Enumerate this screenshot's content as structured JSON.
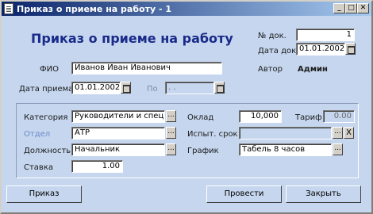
{
  "window": {
    "title": "Приказ о приеме на работу - 1"
  },
  "heading": "Приказ о приеме на работу",
  "doc_no": {
    "label": "№ док.",
    "value": "1"
  },
  "doc_date": {
    "label": "Дата док.",
    "value": "01.01.2002"
  },
  "author": {
    "label": "Автор",
    "value": "Админ"
  },
  "fio": {
    "label": "ФИО",
    "value": "Иванов Иван Иванович"
  },
  "hire_date": {
    "label": "Дата приема",
    "value": "01.01.2002"
  },
  "to_date": {
    "label": "По",
    "value": " .  .  "
  },
  "category": {
    "label": "Категория",
    "value": "Руководители и специали"
  },
  "department": {
    "label": "Отдел",
    "value": "АТР"
  },
  "position": {
    "label": "Должность",
    "value": "Начальник"
  },
  "rate": {
    "label": "Ставка",
    "value": "1.00"
  },
  "salary": {
    "label": "Оклад",
    "value": "10,000"
  },
  "tariff": {
    "label": "Тариф",
    "value": "0.00"
  },
  "probation": {
    "label": "Испыт. срок",
    "value": ""
  },
  "schedule": {
    "label": "График",
    "value": "Табель 8 часов"
  },
  "buttons": {
    "order": "Приказ",
    "post": "Провести",
    "close": "Закрыть"
  },
  "icons": {
    "lookup": "...",
    "clear": "X"
  }
}
